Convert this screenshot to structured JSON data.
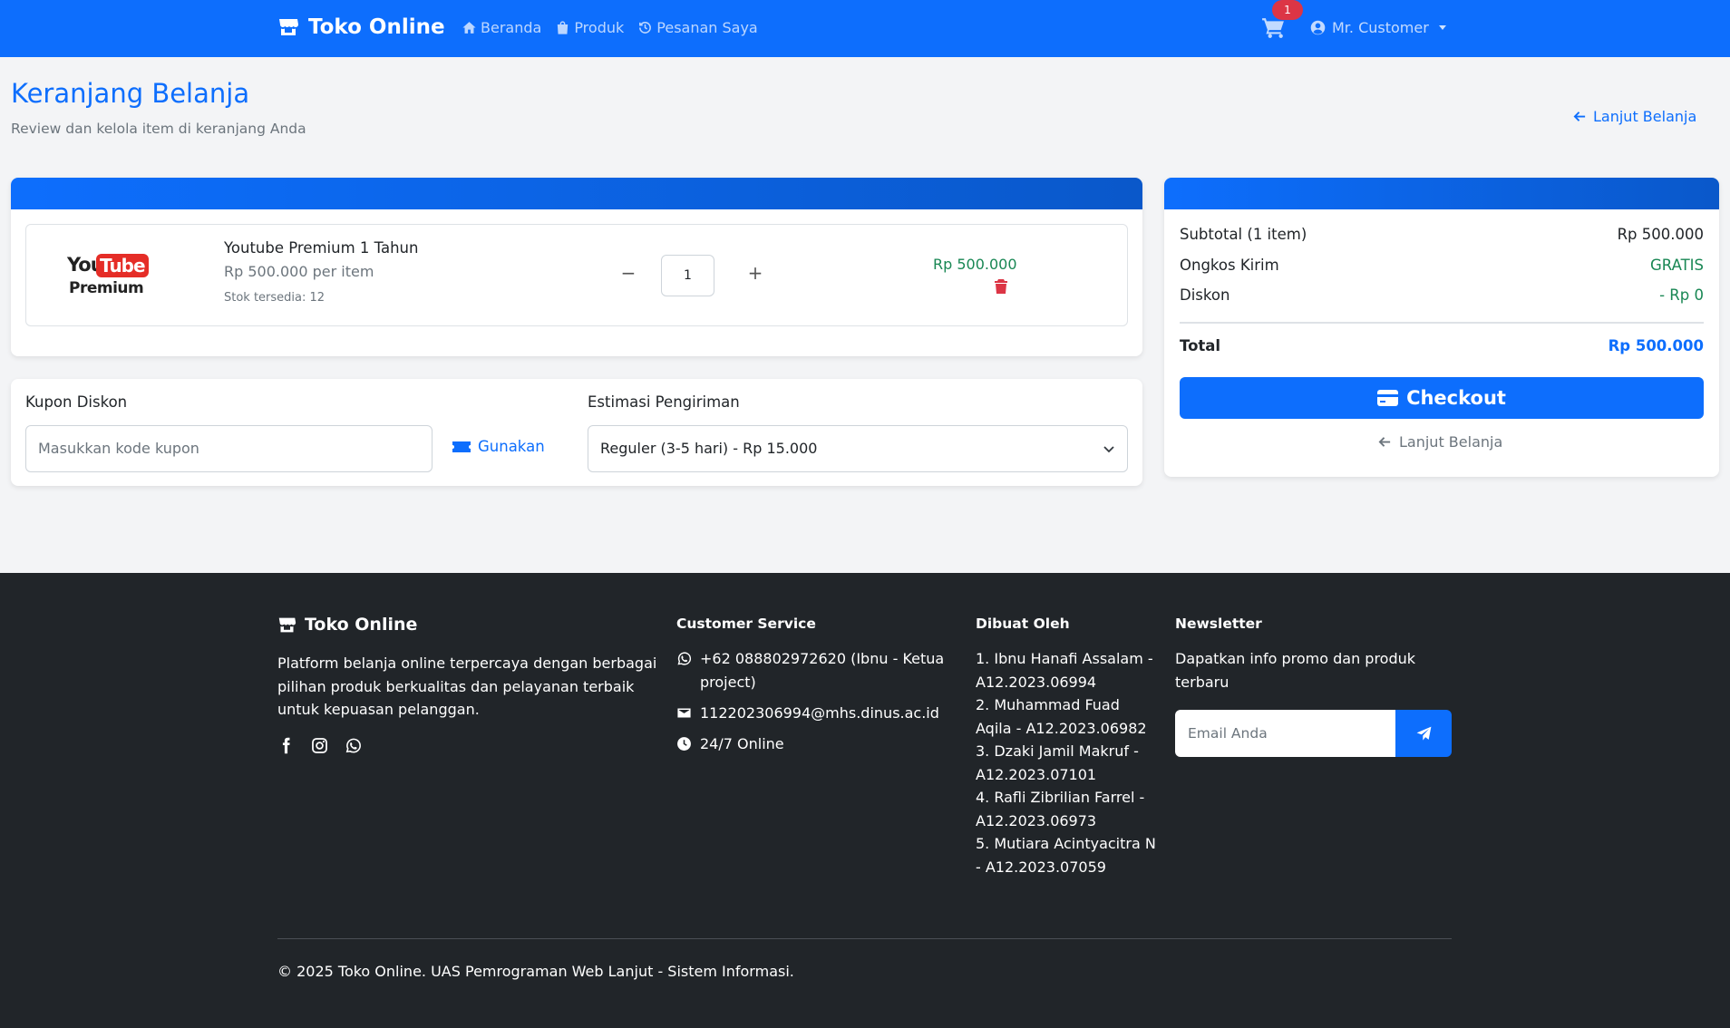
{
  "navbar": {
    "brand": "Toko Online",
    "links": [
      "Beranda",
      "Produk",
      "Pesanan Saya"
    ],
    "cart_count": "1",
    "user": "Mr. Customer"
  },
  "header": {
    "title": "Keranjang Belanja",
    "subtitle": "Review dan kelola item di keranjang Anda",
    "continue": "Lanjut Belanja"
  },
  "cart": {
    "item": {
      "logo_you": "You",
      "logo_tube": "Tube",
      "logo_premium": "Premium",
      "name": "Youtube Premium 1 Tahun",
      "unit_price": "Rp 500.000 per item",
      "stock": "Stok tersedia: 12",
      "minus": "−",
      "quantity": "1",
      "plus": "+",
      "total": "Rp 500.000"
    }
  },
  "coupon": {
    "label": "Kupon Diskon",
    "placeholder": "Masukkan kode kupon",
    "button": "Gunakan"
  },
  "shipping": {
    "label": "Estimasi Pengiriman",
    "selected": "Reguler (3-5 hari) - Rp 15.000"
  },
  "summary": {
    "subtotal_label": "Subtotal (1 item)",
    "subtotal_value": "Rp 500.000",
    "shipping_label": "Ongkos Kirim",
    "shipping_value": "GRATIS",
    "discount_label": "Diskon",
    "discount_value": "- Rp 0",
    "total_label": "Total",
    "total_value": "Rp 500.000",
    "checkout": "Checkout",
    "continue": "Lanjut Belanja"
  },
  "footer": {
    "brand": "Toko Online",
    "description": "Platform belanja online terpercaya dengan berbagai pilihan produk berkualitas dan pelayanan terbaik untuk kepuasan pelanggan.",
    "cs_title": "Customer Service",
    "cs_phone": "+62 088802972620 (Ibnu - Ketua project)",
    "cs_email": "112202306994@mhs.dinus.ac.id",
    "cs_hours": "24/7 Online",
    "dev_title": "Dibuat Oleh",
    "devs": [
      "1. Ibnu Hanafi Assalam - A12.2023.06994",
      "2. Muhammad Fuad Aqila - A12.2023.06982",
      "3. Dzaki Jamil Makruf - A12.2023.07101",
      "4. Rafli Zibrilian Farrel - A12.2023.06973",
      "5. Mutiara Acintyacitra N - A12.2023.07059"
    ],
    "nl_title": "Newsletter",
    "nl_text": "Dapatkan info promo dan produk terbaru",
    "nl_placeholder": "Email Anda",
    "copyright": "© 2025 Toko Online. UAS Pemrograman Web Lanjut - Sistem Informasi."
  },
  "colors": {
    "primary": "#0d6efd",
    "success": "#198754",
    "danger": "#dc3545",
    "footer_bg": "#212529"
  },
  "icons": [
    "store-icon",
    "home-icon",
    "bag-icon",
    "history-icon",
    "cart-icon",
    "user-circle-icon",
    "arrow-left-icon",
    "trash-icon",
    "ticket-icon",
    "chevron-down-icon",
    "credit-card-icon",
    "facebook-icon",
    "instagram-icon",
    "whatsapp-icon",
    "envelope-icon",
    "clock-icon",
    "send-icon"
  ]
}
